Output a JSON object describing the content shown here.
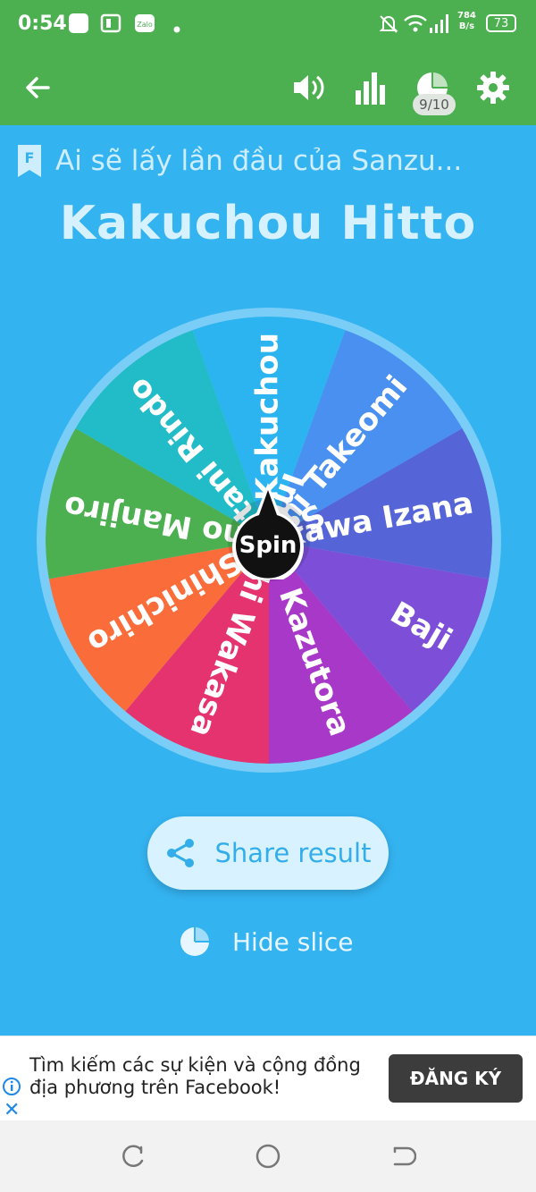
{
  "status_bar": {
    "time": "0:54",
    "net_speed_value": "784",
    "net_speed_unit": "B/s",
    "battery": "73"
  },
  "toolbar": {
    "back_icon": "arrow-left-icon",
    "sound_icon": "volume-icon",
    "stats_icon": "bar-chart-icon",
    "slices_icon": "pie-chart-icon",
    "slice_count": "9/10",
    "settings_icon": "gear-icon",
    "background": "#4caf50"
  },
  "wheel": {
    "subtitle": "Ai sẽ lấy lần đầu của Sanzu...",
    "title": "Kakuchou Hitto",
    "spin_label": "Spin",
    "segments": [
      {
        "label": "Kakuchou",
        "color": "#2bb4f0"
      },
      {
        "label": "Akashi Takeomi",
        "color": "#4a90f0"
      },
      {
        "label": "Kurokawa Izana",
        "color": "#5565d8"
      },
      {
        "label": "Baji",
        "color": "#7d4fd8"
      },
      {
        "label": "Kazutora",
        "color": "#a838c8"
      },
      {
        "label": "Imaushi Wakasa",
        "color": "#e4336e"
      },
      {
        "label": "Sano Shinichiro",
        "color": "#fa6c3a"
      },
      {
        "label": "Sano Manjiro",
        "color": "#4caf50"
      },
      {
        "label": "Haitani Rindo",
        "color": "#21bcc8"
      }
    ],
    "background": "#34b3f1"
  },
  "actions": {
    "share_label": "Share result",
    "share_icon": "share-icon",
    "hide_label": "Hide slice",
    "hide_icon": "pie-chart-icon"
  },
  "ad": {
    "text": "Tìm kiếm các sự kiện và cộng đồng địa phương trên Facebook!",
    "cta": "ĐĂNG KÝ",
    "info_icon": "info-icon",
    "close_icon": "close-icon"
  },
  "nav": {
    "recents_icon": "recents-icon",
    "home_icon": "home-icon",
    "back_icon": "back-icon"
  }
}
